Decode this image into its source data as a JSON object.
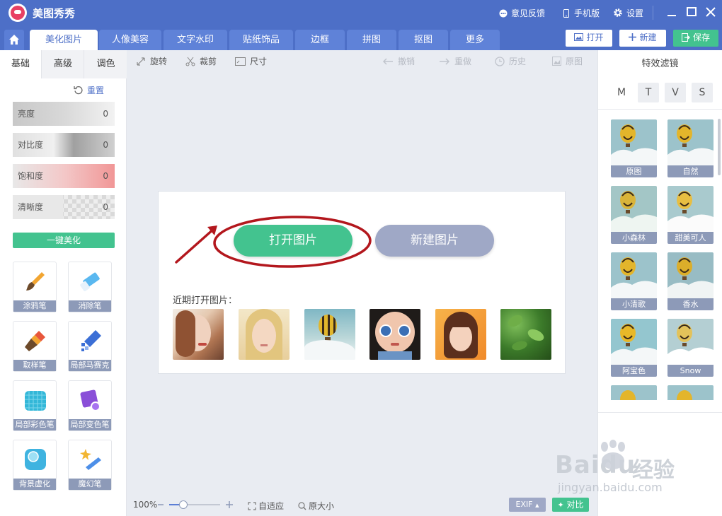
{
  "app": {
    "title": "美图秀秀"
  },
  "titlebar": {
    "feedback": "意见反馈",
    "mobile": "手机版",
    "settings": "设置"
  },
  "tabs": [
    "美化图片",
    "人像美容",
    "文字水印",
    "贴纸饰品",
    "边框",
    "拼图",
    "抠图",
    "更多"
  ],
  "actions": {
    "open": "打开",
    "new": "新建",
    "save": "保存"
  },
  "left": {
    "tabs": [
      "基础",
      "高级",
      "调色"
    ],
    "reset": "重置",
    "sliders": [
      {
        "label": "亮度",
        "value": "0"
      },
      {
        "label": "对比度",
        "value": "0"
      },
      {
        "label": "饱和度",
        "value": "0"
      },
      {
        "label": "清晰度",
        "value": "0"
      }
    ],
    "one_click": "一键美化",
    "tools": [
      "涂鸦笔",
      "消除笔",
      "取样笔",
      "局部马赛克",
      "局部彩色笔",
      "局部变色笔",
      "背景虚化",
      "魔幻笔"
    ]
  },
  "toolbar": {
    "rotate": "旋转",
    "crop": "裁剪",
    "size": "尺寸",
    "undo": "撤销",
    "redo": "重做",
    "history": "历史",
    "original": "原图"
  },
  "center": {
    "open_image": "打开图片",
    "new_image": "新建图片",
    "recent_label": "近期打开图片："
  },
  "right": {
    "title": "特效滤镜",
    "letters": [
      "M",
      "T",
      "V",
      "S"
    ],
    "filters": [
      "原图",
      "自然",
      "小森林",
      "甜美可人",
      "小清歌",
      "香水",
      "阿宝色",
      "Snow"
    ]
  },
  "bottom": {
    "zoom": "100%",
    "fit": "自适应",
    "original_size": "原大小",
    "exif": "EXIF",
    "compare": "对比"
  },
  "watermark": {
    "brand": "Baidu",
    "brand_cn": "经验",
    "url": "jingyan.baidu.com"
  },
  "colors": {
    "titlebar": "#4d6fc7",
    "primary_green": "#43c38f",
    "secondary": "#9fa8c6",
    "highlight_red": "#b3171d"
  }
}
